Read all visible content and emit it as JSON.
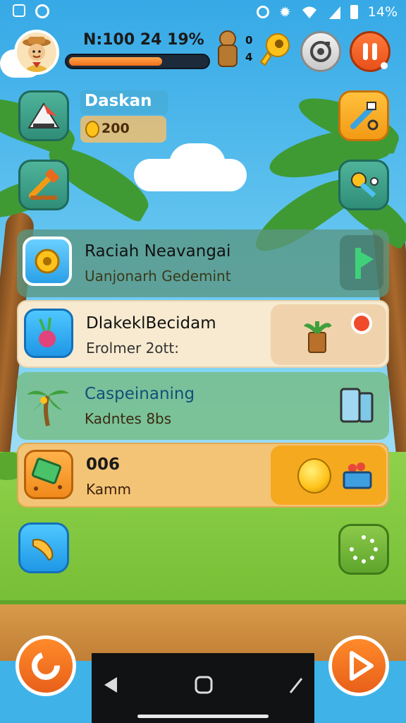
{
  "status_bar": {
    "left_icons": [
      "square-outline-icon",
      "link-icon"
    ],
    "right_icons": [
      "circle-icon",
      "gear-icon",
      "wifi-icon",
      "signal-icon",
      "battery-icon"
    ],
    "battery": "14%"
  },
  "hud": {
    "stats_text": "N:100 24 19%",
    "progress": 0.68
  },
  "resources": {
    "top_value": "0",
    "bottom_value": "4"
  },
  "profile": {
    "name": "Daskan",
    "coins": "200"
  },
  "rows": [
    {
      "title": "Raciah Neavangai",
      "subtitle": "Uanjonarh Gedemint",
      "icon": "gear-icon",
      "action_icon": "flag-icon"
    },
    {
      "title": "DlakeklBecidam",
      "subtitle": "Erolmer 2ott:",
      "icon": "beet-icon",
      "action_icon": "potted-plant-icon",
      "badge_icon": "heart-badge-icon"
    },
    {
      "title": "Caspeinaning",
      "subtitle": "Kadntes 8bs",
      "icon": "palm-icon",
      "action_icon": "phones-icon"
    },
    {
      "title": "006",
      "subtitle": "Kamm",
      "icon": "book-icon",
      "action_icon": "basket-icon",
      "coin_icon": "gold-coin-icon"
    }
  ],
  "colors": {
    "accent_orange": "#f3701a",
    "panel_cream": "#f7ead0",
    "panel_green": "#7fc08e",
    "sky": "#36a9e6"
  }
}
